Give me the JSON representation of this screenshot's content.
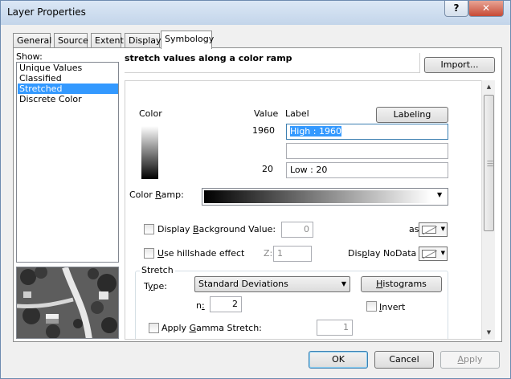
{
  "window": {
    "title": "Layer Properties",
    "help_glyph": "?",
    "close_glyph": "✕"
  },
  "tabs": [
    {
      "label": "General",
      "active": false
    },
    {
      "label": "Source",
      "active": false
    },
    {
      "label": "Extent",
      "active": false
    },
    {
      "label": "Display",
      "active": false
    },
    {
      "label": "Symbology",
      "active": true
    }
  ],
  "show": {
    "label": "Show:",
    "items": [
      "Unique Values",
      "Classified",
      "Stretched",
      "Discrete Color"
    ],
    "selected_index": 2
  },
  "description": "stretch values along a color ramp",
  "import_button": "Import...",
  "color_header": "Color",
  "value_header": "Value",
  "label_header": "Label",
  "labeling_button": "Labeling",
  "high": {
    "value": "1960",
    "label": "High : 1960"
  },
  "middle_label": "",
  "low": {
    "value": "20",
    "label": "Low : 20"
  },
  "color_ramp": {
    "label": "Color Ramp:",
    "from": "#000000",
    "to": "#ffffff"
  },
  "background": {
    "label": "Display Background Value:",
    "value": "0",
    "as_label": "as",
    "checked": false
  },
  "hillshade": {
    "label": "Use hillshade effect",
    "z_label": "Z:",
    "z_value": "1",
    "nodata_label": "Display NoData as",
    "checked": false
  },
  "stretch": {
    "group_label": "Stretch",
    "type_label": "Type:",
    "type_value": "Standard Deviations",
    "histograms_button": "Histograms",
    "n_label": "n:",
    "n_value": "2",
    "invert_label": "Invert",
    "invert_checked": false,
    "gamma_label": "Apply Gamma Stretch:",
    "gamma_value": "1",
    "gamma_checked": false
  },
  "buttons": {
    "ok": "OK",
    "cancel": "Cancel",
    "apply": "Apply"
  },
  "icons": {
    "dropdown": "chevron-down-icon",
    "scroll_up": "scroll-up-icon",
    "scroll_down": "scroll-down-icon"
  }
}
